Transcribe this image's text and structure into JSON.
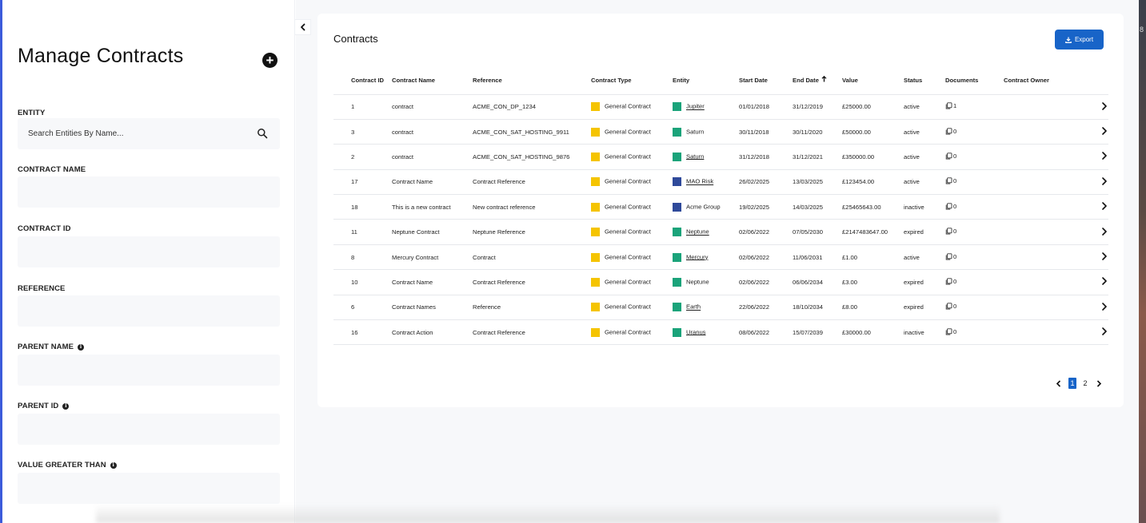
{
  "sidebar": {
    "title": "Manage Contracts",
    "entity_label": "ENTITY",
    "entity_placeholder": "Search Entities By Name...",
    "contract_name_label": "CONTRACT NAME",
    "contract_id_label": "CONTRACT ID",
    "reference_label": "REFERENCE",
    "parent_name_label": "PARENT NAME",
    "parent_id_label": "PARENT ID",
    "value_greater_label": "VALUE GREATER THAN"
  },
  "main": {
    "title": "Contracts",
    "export_label": "Export",
    "columns": {
      "id": "Contract ID",
      "name": "Contract Name",
      "reference": "Reference",
      "type": "Contract Type",
      "entity": "Entity",
      "start": "Start Date",
      "end": "End Date",
      "value": "Value",
      "status": "Status",
      "documents": "Documents",
      "owner": "Contract Owner"
    },
    "rows": [
      {
        "id": "1",
        "name": "contract",
        "reference": "ACME_CON_DP_1234",
        "type": "General Contract",
        "entity": "Jupiter",
        "entity_color": "#1aa37a",
        "entity_link": true,
        "start": "01/01/2018",
        "end": "31/12/2019",
        "value": "£25000.00",
        "status": "active",
        "docs": "1"
      },
      {
        "id": "3",
        "name": "contract",
        "reference": "ACME_CON_SAT_HOSTING_9911",
        "type": "General Contract",
        "entity": "Saturn",
        "entity_color": "#1aa37a",
        "entity_link": false,
        "start": "30/11/2018",
        "end": "30/11/2020",
        "value": "£50000.00",
        "status": "active",
        "docs": "0"
      },
      {
        "id": "2",
        "name": "contract",
        "reference": "ACME_CON_SAT_HOSTING_9876",
        "type": "General Contract",
        "entity": "Saturn",
        "entity_color": "#1aa37a",
        "entity_link": true,
        "start": "31/12/2018",
        "end": "31/12/2021",
        "value": "£350000.00",
        "status": "active",
        "docs": "0"
      },
      {
        "id": "17",
        "name": "Contract Name",
        "reference": "Contract Reference",
        "type": "General Contract",
        "entity": "MAO Risk",
        "entity_color": "#2f4a9a",
        "entity_link": true,
        "start": "26/02/2025",
        "end": "13/03/2025",
        "value": "£123454.00",
        "status": "active",
        "docs": "0"
      },
      {
        "id": "18",
        "name": "This is a new contract",
        "reference": "New contract reference",
        "type": "General Contract",
        "entity": "Acme Group",
        "entity_color": "#2f4a9a",
        "entity_link": false,
        "start": "19/02/2025",
        "end": "14/03/2025",
        "value": "£25465643.00",
        "status": "inactive",
        "docs": "0"
      },
      {
        "id": "11",
        "name": "Neptune Contract",
        "reference": "Neptune Reference",
        "type": "General Contract",
        "entity": "Neptune",
        "entity_color": "#1aa37a",
        "entity_link": true,
        "start": "02/06/2022",
        "end": "07/05/2030",
        "value": "£2147483647.00",
        "status": "expired",
        "docs": "0"
      },
      {
        "id": "8",
        "name": "Mercury Contract",
        "reference": "Contract",
        "type": "General Contract",
        "entity": "Mercury",
        "entity_color": "#1aa37a",
        "entity_link": true,
        "start": "02/06/2022",
        "end": "11/06/2031",
        "value": "£1.00",
        "status": "active",
        "docs": "0"
      },
      {
        "id": "10",
        "name": "Contract Name",
        "reference": "Contract Reference",
        "type": "General Contract",
        "entity": "Neptune",
        "entity_color": "#1aa37a",
        "entity_link": false,
        "start": "02/06/2022",
        "end": "06/06/2034",
        "value": "£3.00",
        "status": "expired",
        "docs": "0"
      },
      {
        "id": "6",
        "name": "Contract Names",
        "reference": "Reference",
        "type": "General Contract",
        "entity": "Earth",
        "entity_color": "#1aa37a",
        "entity_link": true,
        "start": "22/06/2022",
        "end": "18/10/2034",
        "value": "£8.00",
        "status": "expired",
        "docs": "0"
      },
      {
        "id": "16",
        "name": "Contract Action",
        "reference": "Contract Reference",
        "type": "General Contract",
        "entity": "Uranus",
        "entity_color": "#1aa37a",
        "entity_link": true,
        "start": "08/06/2022",
        "end": "15/07/2039",
        "value": "£30000.00",
        "status": "inactive",
        "docs": "0"
      }
    ],
    "type_color": "#f5c400",
    "pagination": {
      "pages": [
        "1",
        "2"
      ],
      "current": "1"
    }
  },
  "colors": {
    "accent": "#1864c8",
    "sidebar_accent": "#3b5bdb"
  },
  "side_number": "8"
}
